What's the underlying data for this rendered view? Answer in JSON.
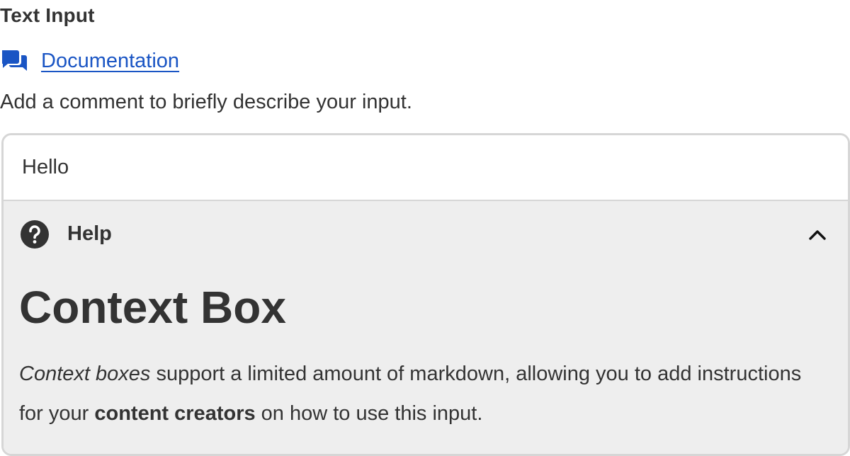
{
  "field": {
    "label": "Text Input",
    "doc_link": "Documentation",
    "description": "Add a comment to briefly describe your input.",
    "input_value": "Hello"
  },
  "help": {
    "title": "Help",
    "expanded": true,
    "heading": "Context Box",
    "body": {
      "em_text": "Context boxes",
      "text_1": " support a limited amount of markdown, allowing you to add instructions for your ",
      "strong_text": "content creators",
      "text_2": " on how to use this input."
    }
  },
  "icons": {
    "doc": "chat-bubbles-icon",
    "help": "question-circle-icon",
    "toggle": "chevron-up-icon"
  },
  "colors": {
    "link": "#1a55c4",
    "text": "#333333",
    "panel_bg": "#eeeeee",
    "border": "#d6d6d6"
  }
}
